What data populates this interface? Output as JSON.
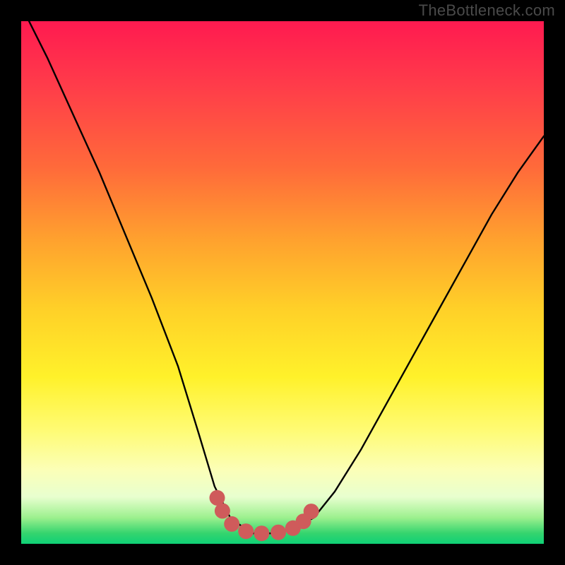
{
  "watermark": "TheBottleneck.com",
  "chart_data": {
    "type": "line",
    "title": "",
    "xlabel": "",
    "ylabel": "",
    "xlim": [
      0,
      1
    ],
    "ylim": [
      0,
      1
    ],
    "series": [
      {
        "name": "main-curve",
        "x": [
          0.0,
          0.05,
          0.1,
          0.15,
          0.2,
          0.25,
          0.3,
          0.34,
          0.37,
          0.4,
          0.44,
          0.48,
          0.52,
          0.56,
          0.6,
          0.65,
          0.7,
          0.75,
          0.8,
          0.85,
          0.9,
          0.95,
          1.0
        ],
        "y": [
          1.03,
          0.93,
          0.82,
          0.71,
          0.59,
          0.47,
          0.34,
          0.21,
          0.11,
          0.05,
          0.02,
          0.02,
          0.03,
          0.05,
          0.1,
          0.18,
          0.27,
          0.36,
          0.45,
          0.54,
          0.63,
          0.71,
          0.78
        ]
      },
      {
        "name": "marker-dots",
        "x": [
          0.375,
          0.385,
          0.403,
          0.43,
          0.46,
          0.492,
          0.52,
          0.54,
          0.555
        ],
        "y": [
          0.088,
          0.063,
          0.038,
          0.024,
          0.02,
          0.022,
          0.03,
          0.043,
          0.062
        ]
      }
    ],
    "gradient_stops": [
      {
        "pos": 0.0,
        "color": "#ff1a50"
      },
      {
        "pos": 0.28,
        "color": "#ff6a3a"
      },
      {
        "pos": 0.55,
        "color": "#ffd028"
      },
      {
        "pos": 0.78,
        "color": "#fffb72"
      },
      {
        "pos": 0.95,
        "color": "#9cf08e"
      },
      {
        "pos": 1.0,
        "color": "#0fd176"
      }
    ]
  }
}
